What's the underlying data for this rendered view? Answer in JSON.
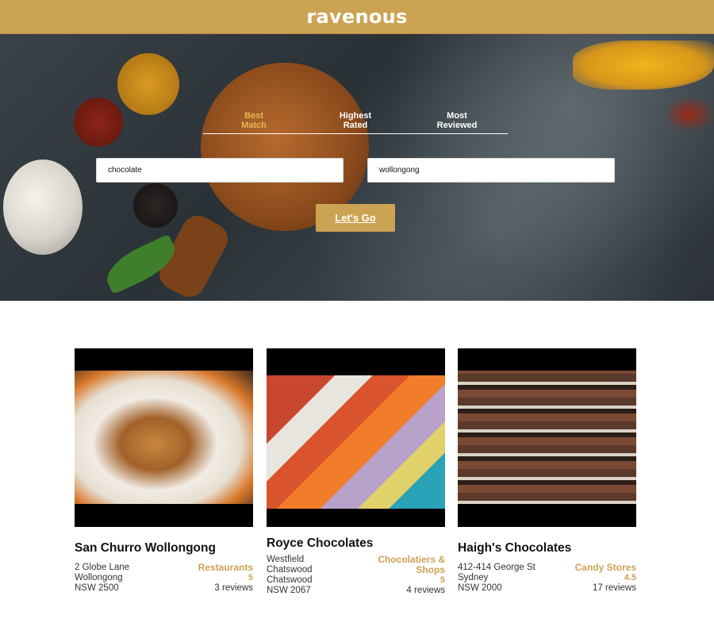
{
  "header": {
    "logo": "ravenous"
  },
  "search": {
    "sort_options": [
      "Best\nMatch",
      "Highest\nRated",
      "Most\nReviewed"
    ],
    "active_sort": "Best Match",
    "term": "chocolate",
    "location": "wollongong",
    "submit_label": "Let's Go"
  },
  "results": [
    {
      "name": "San Churro Wollongong",
      "address": [
        "2 Globe Lane",
        "Wollongong",
        "NSW 2500"
      ],
      "category": "Restaurants",
      "rating": "5",
      "reviews": "3 reviews"
    },
    {
      "name": "Royce Chocolates",
      "address": [
        "Westfield",
        "Chatswood",
        "Chatswood",
        "NSW 2067"
      ],
      "category": "Chocolatiers & Shops",
      "rating": "5",
      "reviews": "4 reviews"
    },
    {
      "name": "Haigh's Chocolates",
      "address": [
        "412-414 George St",
        "Sydney",
        "NSW 2000"
      ],
      "category": "Candy Stores",
      "rating": "4.5",
      "reviews": "17 reviews"
    }
  ],
  "colors": {
    "accent": "#cca353",
    "active_tab": "#e6b756"
  }
}
